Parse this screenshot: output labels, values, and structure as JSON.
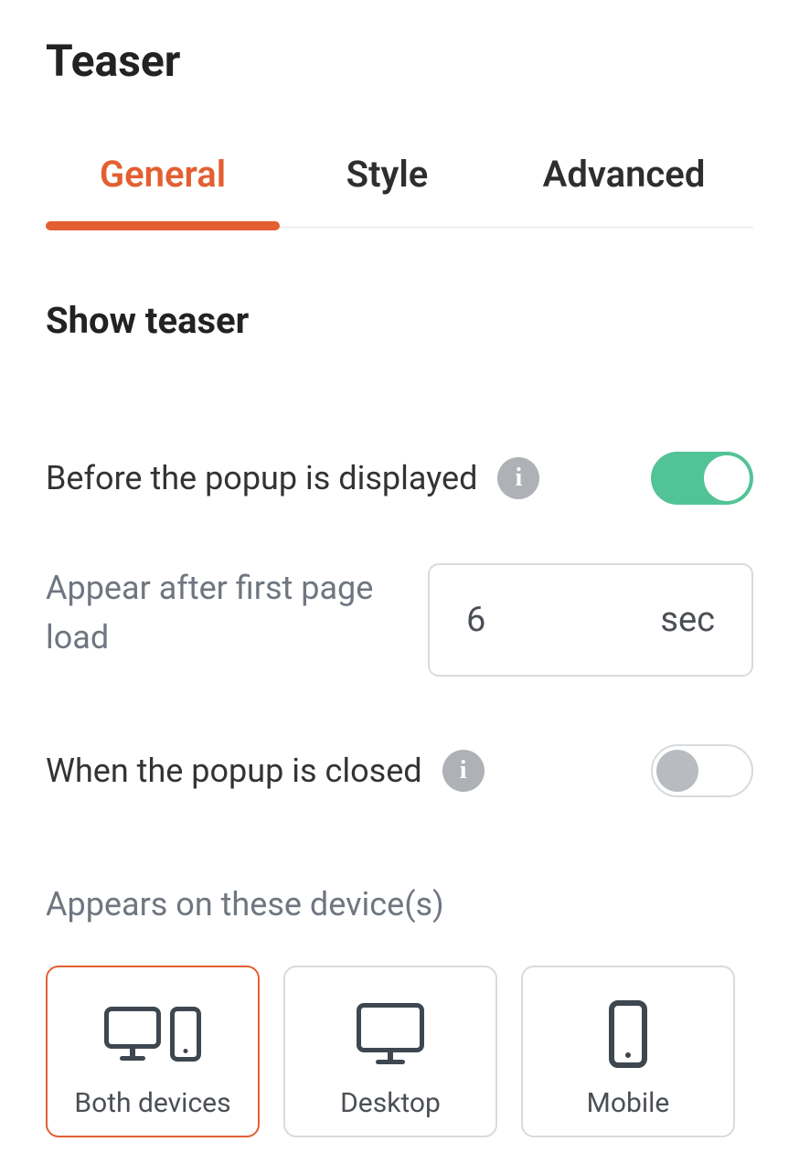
{
  "header": {
    "title": "Teaser"
  },
  "tabs": [
    {
      "label": "General",
      "active": true
    },
    {
      "label": "Style",
      "active": false
    },
    {
      "label": "Advanced",
      "active": false
    }
  ],
  "section": {
    "title": "Show teaser"
  },
  "settings": {
    "before_displayed": {
      "label": "Before the popup is displayed",
      "on": true
    },
    "appear_after": {
      "label": "Appear after first page load",
      "value": "6",
      "unit": "sec"
    },
    "when_closed": {
      "label": "When the popup is closed",
      "on": false
    },
    "devices": {
      "label": "Appears on these device(s)",
      "options": [
        {
          "label": "Both devices",
          "selected": true
        },
        {
          "label": "Desktop",
          "selected": false
        },
        {
          "label": "Mobile",
          "selected": false
        }
      ]
    }
  }
}
